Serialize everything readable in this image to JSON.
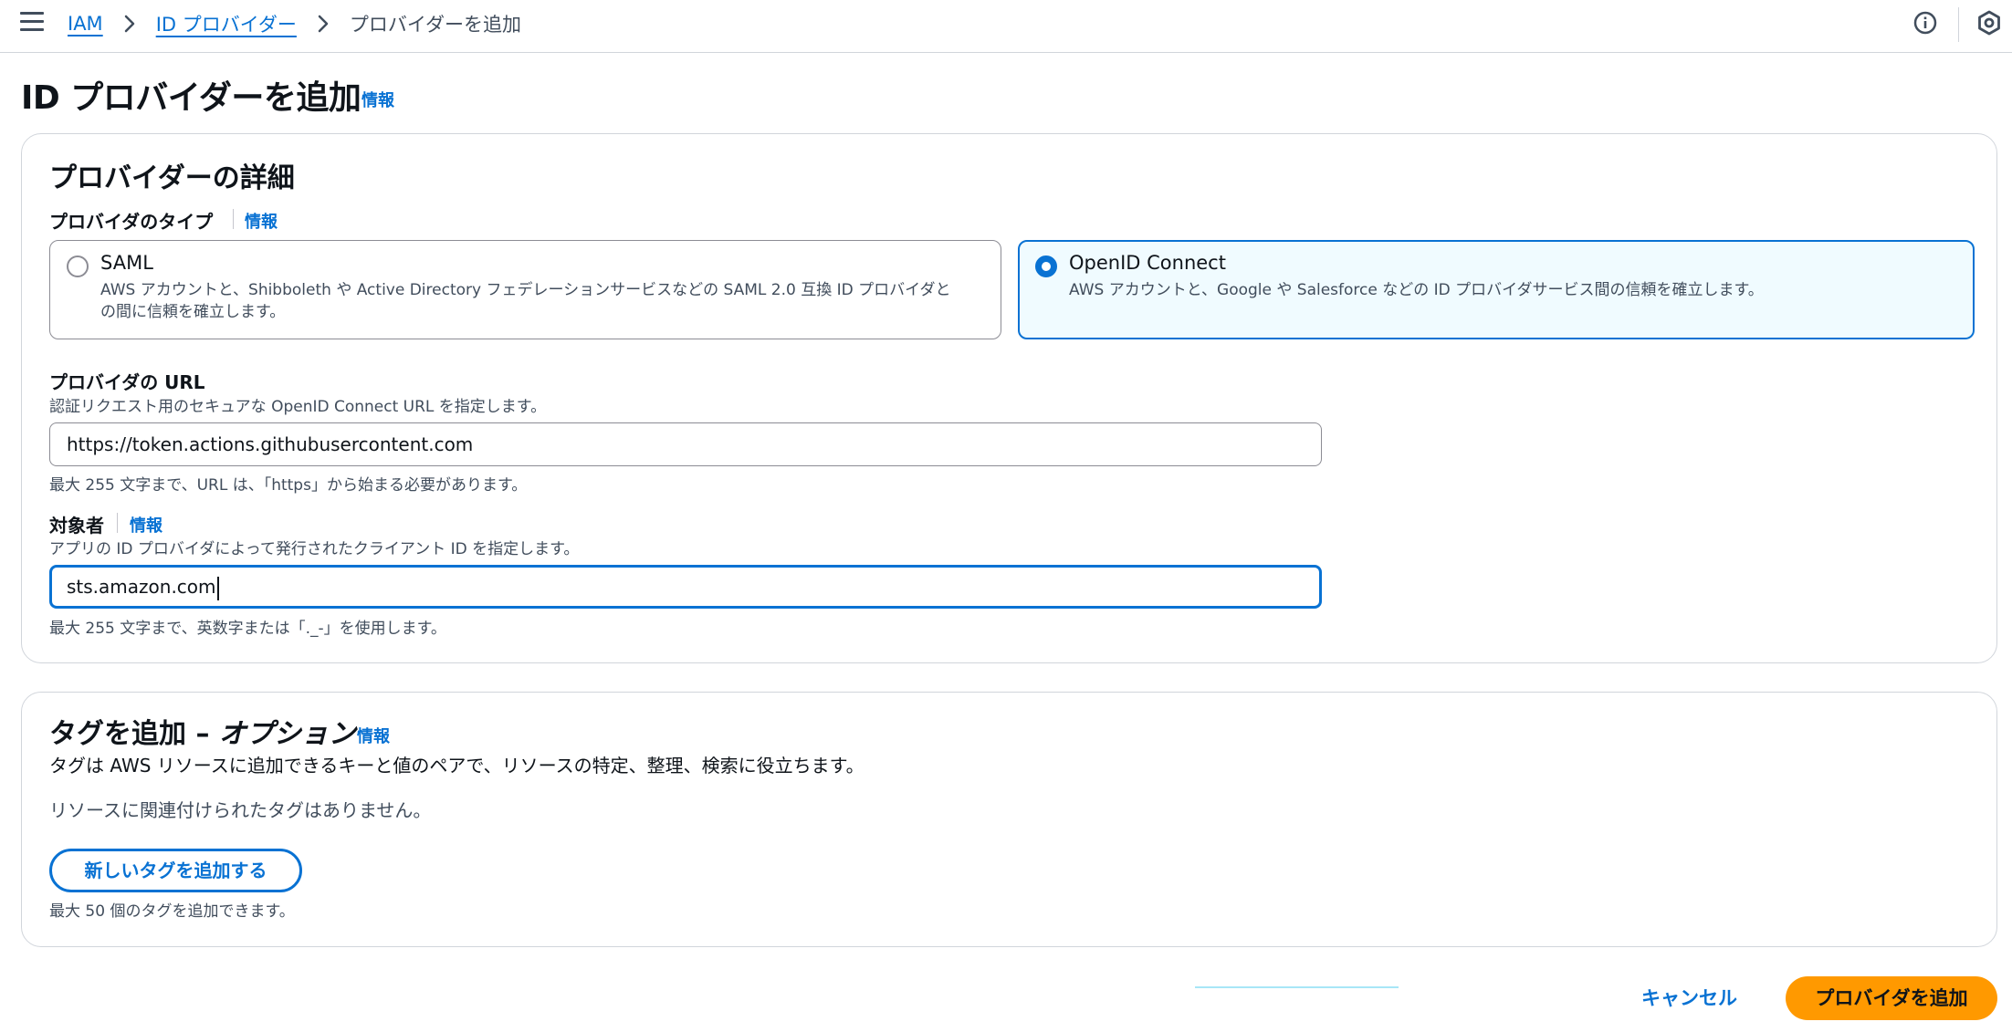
{
  "breadcrumb": {
    "items": [
      "IAM",
      "ID プロバイダー"
    ],
    "current": "プロバイダーを追加"
  },
  "header": {
    "title": "ID プロバイダーを追加",
    "info": "情報"
  },
  "details": {
    "heading": "プロバイダーの詳細",
    "provider_type_label": "プロバイダのタイプ",
    "provider_type_info": "情報",
    "options": [
      {
        "title": "SAML",
        "desc_line1": "AWS アカウントと、Shibboleth や Active Directory フェデレーションサービスなどの SAML 2.0 互換 ID プロバイダと",
        "desc_line2": "の間に信頼を確立します。",
        "selected": false
      },
      {
        "title": "OpenID Connect",
        "desc_line1": "AWS アカウントと、Google や Salesforce などの ID プロバイダサービス間の信頼を確立します。",
        "desc_line2": "",
        "selected": true
      }
    ],
    "url_label": "プロバイダの URL",
    "url_desc": "認証リクエスト用のセキュアな OpenID Connect URL を指定します。",
    "url_value": "https://token.actions.githubusercontent.com",
    "url_constraint": "最大 255 文字まで、URL は、「https」から始まる必要があります。",
    "audience_label": "対象者",
    "audience_info": "情報",
    "audience_desc": "アプリの ID プロバイダによって発行されたクライアント ID を指定します。",
    "audience_value": "sts.amazon.com",
    "audience_constraint": "最大 255 文字まで、英数字または「._-」を使用します。"
  },
  "tags": {
    "title_main": "タグを追加 – ",
    "title_optional": "オプション",
    "info": "情報",
    "description": "タグは AWS リソースに追加できるキーと値のペアで、リソースの特定、整理、検索に役立ちます。",
    "empty_text": "リソースに関連付けられたタグはありません。",
    "add_button": "新しいタグを追加する",
    "limit_text": "最大 50 個のタグを追加できます。"
  },
  "footer": {
    "cancel": "キャンセル",
    "submit": "プロバイダを追加"
  },
  "colors": {
    "accent": "#0972d3",
    "primary_button": "#ff9900",
    "selected_tile_bg": "#f0fbff"
  }
}
